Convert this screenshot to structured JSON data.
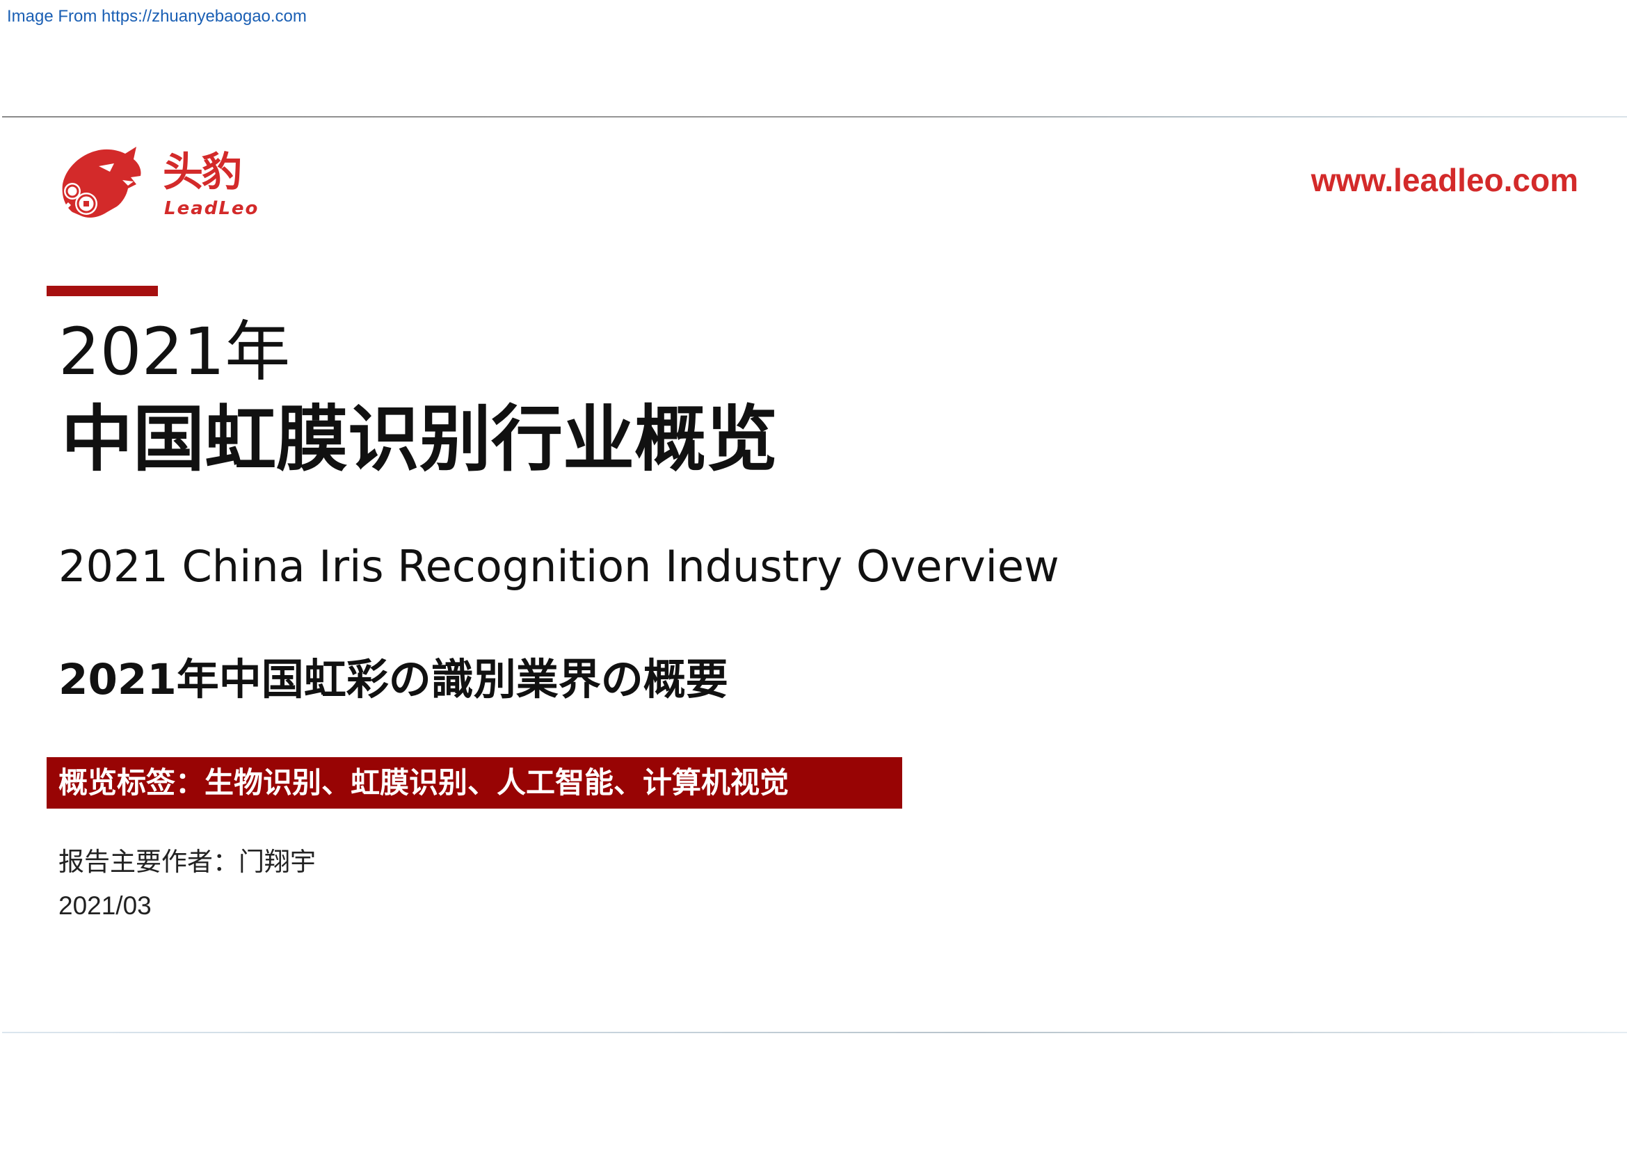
{
  "header": {
    "source_link": "Image From https://zhuanyebaogao.com"
  },
  "brand": {
    "logo_cn": "头豹",
    "logo_en": "LeadLeo",
    "website": "www.leadleo.com",
    "color": "#d32a2a"
  },
  "cover": {
    "title_year": "2021年",
    "title_main": "中国虹膜识别行业概览",
    "title_en": "2021 China Iris Recognition Industry Overview",
    "title_jp": "2021年中国虹彩の識別業界の概要",
    "tags_line": "概览标签：生物识别、虹膜识别、人工智能、计算机视觉",
    "tag_bg_color": "#980404",
    "author_line": "报告主要作者：门翔宇",
    "date": "2021/03"
  },
  "icons": [
    "leopard-logo-icon"
  ]
}
